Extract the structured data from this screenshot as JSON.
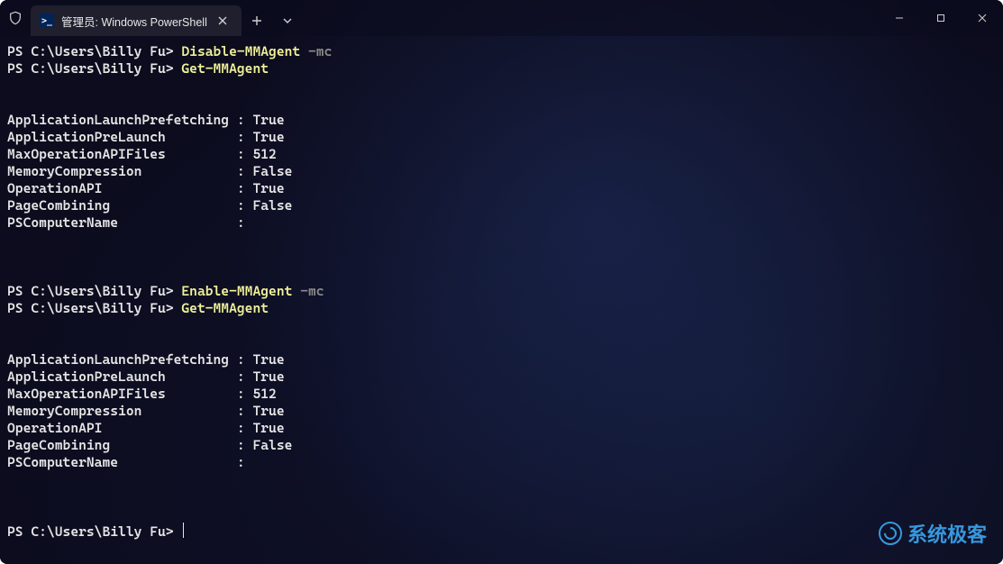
{
  "titlebar": {
    "tab_title": "管理员: Windows PowerShell",
    "ps_icon_glyph": ">_"
  },
  "watermark": {
    "text": "系统极客"
  },
  "prompt": "PS C:\\Users\\Billy Fu> ",
  "commands": [
    {
      "prompt": "PS C:\\Users\\Billy Fu> ",
      "cmd": "Disable-MMAgent",
      "arg": " -mc"
    },
    {
      "prompt": "PS C:\\Users\\Billy Fu> ",
      "cmd": "Get-MMAgent",
      "arg": ""
    }
  ],
  "output1": [
    {
      "key": "ApplicationLaunchPrefetching",
      "sep": " : ",
      "val": "True"
    },
    {
      "key": "ApplicationPreLaunch        ",
      "sep": " : ",
      "val": "True"
    },
    {
      "key": "MaxOperationAPIFiles        ",
      "sep": " : ",
      "val": "512"
    },
    {
      "key": "MemoryCompression           ",
      "sep": " : ",
      "val": "False"
    },
    {
      "key": "OperationAPI                ",
      "sep": " : ",
      "val": "True"
    },
    {
      "key": "PageCombining               ",
      "sep": " : ",
      "val": "False"
    },
    {
      "key": "PSComputerName              ",
      "sep": " :",
      "val": ""
    }
  ],
  "commands2": [
    {
      "prompt": "PS C:\\Users\\Billy Fu> ",
      "cmd": "Enable-MMAgent",
      "arg": " -mc"
    },
    {
      "prompt": "PS C:\\Users\\Billy Fu> ",
      "cmd": "Get-MMAgent",
      "arg": ""
    }
  ],
  "output2": [
    {
      "key": "ApplicationLaunchPrefetching",
      "sep": " : ",
      "val": "True"
    },
    {
      "key": "ApplicationPreLaunch        ",
      "sep": " : ",
      "val": "True"
    },
    {
      "key": "MaxOperationAPIFiles        ",
      "sep": " : ",
      "val": "512"
    },
    {
      "key": "MemoryCompression           ",
      "sep": " : ",
      "val": "True"
    },
    {
      "key": "OperationAPI                ",
      "sep": " : ",
      "val": "True"
    },
    {
      "key": "PageCombining               ",
      "sep": " : ",
      "val": "False"
    },
    {
      "key": "PSComputerName              ",
      "sep": " :",
      "val": ""
    }
  ],
  "final_prompt": "PS C:\\Users\\Billy Fu> "
}
